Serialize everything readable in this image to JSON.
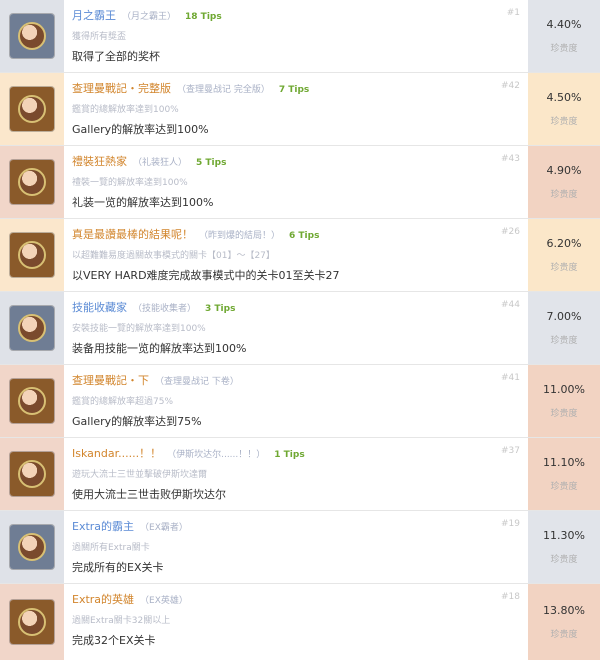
{
  "colors": {
    "title_blue": "#5b8bd5",
    "title_orange": "#d2852c",
    "tips_green": "#6fa832",
    "rate_gray": "#e1e4ea",
    "rate_peach": "#fbe7c9",
    "rate_rose": "#f2d3c2",
    "leftbar_gray": "#dfe2e8",
    "leftbar_peach": "#fbe7cc",
    "leftbar_rose": "#f1d6c9"
  },
  "achievements": [
    {
      "title": "月之霸王",
      "subtitle": "（月之霸王）",
      "tips": "18 Tips",
      "rank": "#1",
      "desc_jp": "獲得所有獎盃",
      "desc": "取得了全部的奖杯",
      "rate": "4.40%",
      "rate_label": "珍贵度",
      "icon": "trophy-king-icon",
      "theme": "gray",
      "title_color": "blue"
    },
    {
      "title": "查理曼戰記・完整版",
      "subtitle": "（查理曼战记 完全版）",
      "tips": "7 Tips",
      "rank": "#42",
      "desc_jp": "鑑賞的總解放率達到100%",
      "desc": "Gallery的解放率达到100%",
      "rate": "4.50%",
      "rate_label": "珍贵度",
      "icon": "charlemagne-icon",
      "theme": "peach",
      "title_color": "orange"
    },
    {
      "title": "禮裝狂熱家",
      "subtitle": "（礼装狂人）",
      "tips": "5 Tips",
      "rank": "#43",
      "desc_jp": "禮裝一覽的解放率達到100%",
      "desc": "礼装一览的解放率达到100%",
      "rate": "4.90%",
      "rate_label": "珍贵度",
      "icon": "mystic-code-icon",
      "theme": "rose",
      "title_color": "orange"
    },
    {
      "title": "真是最讚最棒的結果呢！",
      "subtitle": "（昨到爆的結局！）",
      "tips": "6 Tips",
      "rank": "#26",
      "desc_jp": "以超難難易度過關故事模式的關卡【01】～【27】",
      "desc": "以VERY HARD难度完成故事模式中的关卡01至关卡27",
      "rate": "6.20%",
      "rate_label": "珍贵度",
      "icon": "best-ending-icon",
      "theme": "peach",
      "title_color": "orange"
    },
    {
      "title": "技能收藏家",
      "subtitle": "（技能收集者）",
      "tips": "3 Tips",
      "rank": "#44",
      "desc_jp": "安裝技能一覽的解放率達到100%",
      "desc": "装备用技能一览的解放率达到100%",
      "rate": "7.00%",
      "rate_label": "珍贵度",
      "icon": "skill-collector-icon",
      "theme": "gray",
      "title_color": "blue"
    },
    {
      "title": "查理曼戰記・下",
      "subtitle": "（查理曼战记 下卷）",
      "tips": "",
      "rank": "#41",
      "desc_jp": "鑑賞的總解放率超過75%",
      "desc": "Gallery的解放率达到75%",
      "rate": "11.00%",
      "rate_label": "珍贵度",
      "icon": "charlemagne-volume-icon",
      "theme": "rose",
      "title_color": "orange"
    },
    {
      "title": "Iskandar......！！",
      "subtitle": "（伊斯坎达尔......！！）",
      "tips": "1 Tips",
      "rank": "#37",
      "desc_jp": "遊玩大流士三世並擊破伊斯坎達爾",
      "desc": "使用大流士三世击败伊斯坎达尔",
      "rate": "11.10%",
      "rate_label": "珍贵度",
      "icon": "iskandar-icon",
      "theme": "rose",
      "title_color": "orange"
    },
    {
      "title": "Extra的霸主",
      "subtitle": "（EX霸者）",
      "tips": "",
      "rank": "#19",
      "desc_jp": "過關所有Extra關卡",
      "desc": "完成所有的EX关卡",
      "rate": "11.30%",
      "rate_label": "珍贵度",
      "icon": "extra-ruler-icon",
      "theme": "gray",
      "title_color": "blue"
    },
    {
      "title": "Extra的英雄",
      "subtitle": "（EX英雄）",
      "tips": "",
      "rank": "#18",
      "desc_jp": "過關Extra關卡32關以上",
      "desc": "完成32个EX关卡",
      "rate": "13.80%",
      "rate_label": "珍贵度",
      "icon": "extra-hero-icon",
      "theme": "rose",
      "title_color": "orange"
    }
  ]
}
